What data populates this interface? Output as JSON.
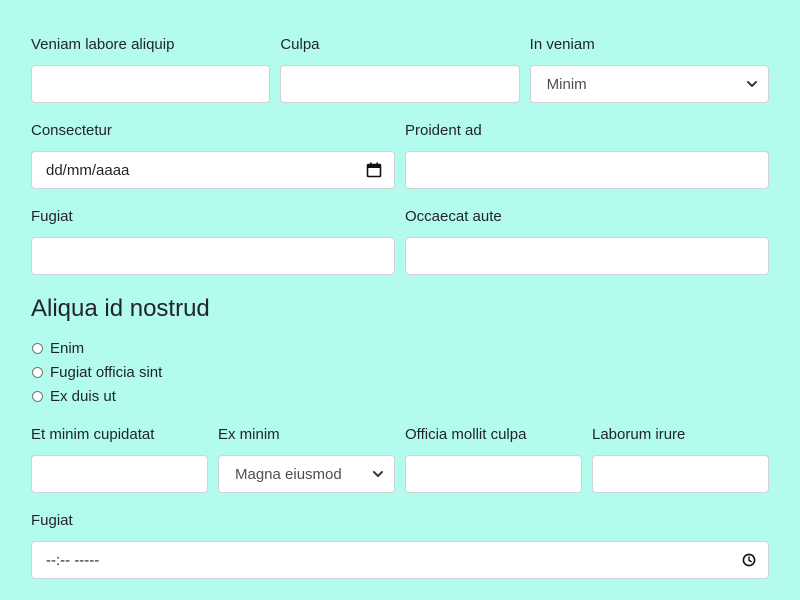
{
  "row1": {
    "field1_label": "Veniam labore aliquip",
    "field1_value": "",
    "field2_label": "Culpa",
    "field2_value": "",
    "field3_label": "In veniam",
    "field3_selected": "Minim"
  },
  "row2": {
    "date_label": "Consectetur",
    "date_placeholder": "dd/mm/aaaa",
    "field2_label": "Proident ad",
    "field2_value": ""
  },
  "row3": {
    "field1_label": "Fugiat",
    "field1_value": "",
    "field2_label": "Occaecat aute",
    "field2_value": ""
  },
  "radio_group": {
    "title": "Aliqua id nostrud",
    "options": [
      "Enim",
      "Fugiat officia sint",
      "Ex duis ut"
    ]
  },
  "row4": {
    "field1_label": "Et minim cupidatat",
    "field1_value": "",
    "field2_label": "Ex minim",
    "field2_selected": "Magna eiusmod",
    "field3_label": "Officia mollit culpa",
    "field3_value": "",
    "field4_label": "Laborum irure",
    "field4_value": ""
  },
  "row5": {
    "time_label": "Fugiat",
    "time_placeholder": "--:-- -----"
  },
  "colors": {
    "background": "#b3fced",
    "input_border": "#ced4da",
    "text": "#212529"
  }
}
